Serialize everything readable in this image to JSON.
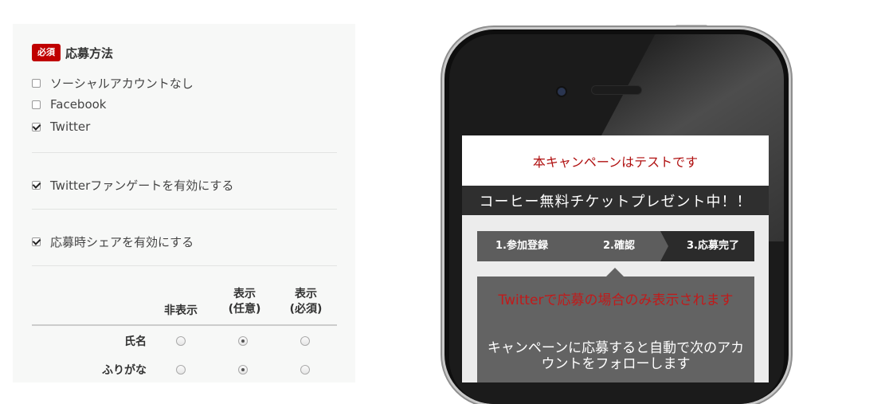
{
  "form": {
    "required_badge": "必須",
    "section_title": "応募方法",
    "options": [
      {
        "label": "ソーシャルアカウントなし",
        "checked": false
      },
      {
        "label": "Facebook",
        "checked": false
      },
      {
        "label": "Twitter",
        "checked": true
      }
    ],
    "twitter_fangate": {
      "label": "Twitterファンゲートを有効にする",
      "checked": true
    },
    "share_on_apply": {
      "label": "応募時シェアを有効にする",
      "checked": true
    },
    "columns": [
      "非表示",
      "表示\n(任意)",
      "表示\n(必須)"
    ],
    "rows": [
      {
        "label": "氏名",
        "selected": 1
      },
      {
        "label": "ふりがな",
        "selected": 1
      }
    ]
  },
  "preview": {
    "notice": "本キャンペーンはテストです",
    "campaign_title": "コーヒー無料チケットプレゼント中！！",
    "steps": [
      "1.参加登録",
      "2.確認",
      "3.応募完了"
    ],
    "active_step": 1,
    "twitter_only_note": "Twitterで応募の場合のみ表示されます",
    "follow_note": "キャンペーンに応募すると自動で次のアカウントをフォローします"
  },
  "colors": {
    "badge": "#c00000",
    "notice_text": "#b01010",
    "step_bg": "#5d5d5d",
    "step_active_bg": "#2b2b2b"
  }
}
